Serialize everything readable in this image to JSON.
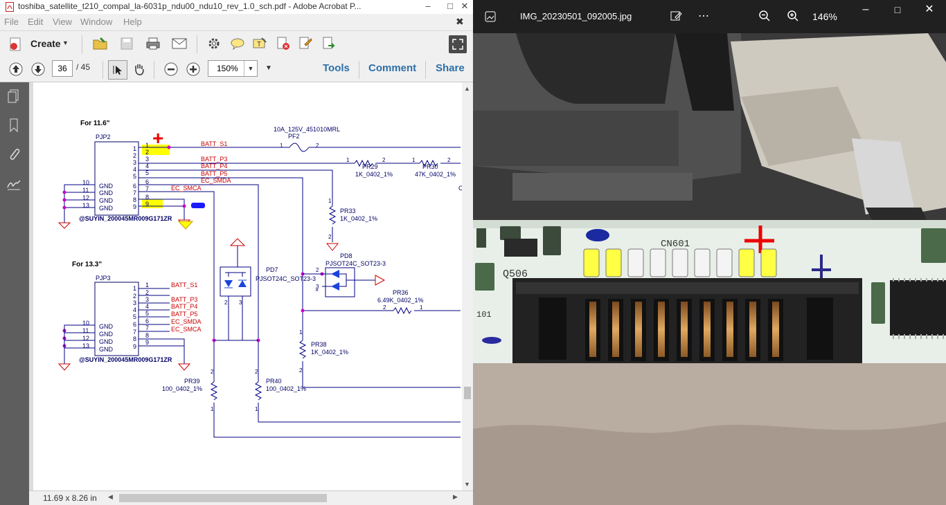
{
  "acrobat": {
    "title": "toshiba_satellite_t210_compal_la-6031p_ndu00_ndu10_rev_1.0_sch.pdf - Adobe Acrobat P...",
    "menu": [
      "File",
      "Edit",
      "View",
      "Window",
      "Help"
    ],
    "toolbar": {
      "create_label": "Create"
    },
    "nav": {
      "page_current": "36",
      "page_total": "/ 45",
      "zoom": "150%"
    },
    "panes": [
      "Tools",
      "Comment",
      "Share"
    ],
    "status": {
      "page_size": "11.69 x 8.26 in"
    }
  },
  "schematic": {
    "sec1_title": "For 11.6\"",
    "sec2_title": "For 13.3\"",
    "conn1_ref": "PJP2",
    "conn2_ref": "PJP3",
    "conn_part": "@SUYIN_200045MR009G171ZR",
    "pin_numbers": [
      "1",
      "2",
      "3",
      "4",
      "5",
      "6",
      "7",
      "8",
      "9",
      "10",
      "11",
      "12",
      "13"
    ],
    "gnd": "GND",
    "nets": [
      "BATT_S1",
      "BATT_P3",
      "BATT_P4",
      "BATT_P5",
      "EC_SMDA",
      "EC_SMCA"
    ],
    "fuse_part": "10A_125V_451010MRL",
    "fuse_ref": "PF2",
    "pr29": {
      "ref": "PR29",
      "val": "1K_0402_1%"
    },
    "pr30": {
      "ref": "PR30",
      "val": "47K_0402_1%"
    },
    "pr33": {
      "ref": "PR33",
      "val": "1K_0402_1%"
    },
    "pr36": {
      "ref": "PR36",
      "val": "6.49K_0402_1%"
    },
    "pr38": {
      "ref": "PR38",
      "val": "1K_0402_1%"
    },
    "pr39": {
      "ref": "PR39",
      "val": "100_0402_1%"
    },
    "pr40": {
      "ref": "PR40",
      "val": "100_0402_1%"
    },
    "pd7": {
      "ref": "PD7",
      "val": "PJSOT24C_SOT23-3"
    },
    "pd8": {
      "ref": "PD8",
      "val": "PJSOT24C_SOT23-3"
    },
    "small_pins": [
      "1",
      "2",
      "3"
    ],
    "edge_c": "C",
    "colors": {
      "net": "#cc0000",
      "text": "#000066",
      "wire": "#000080",
      "marker": "#cc00cc",
      "highlight": "#ffff00"
    }
  },
  "photos": {
    "filename": "IMG_20230501_092005.jpg",
    "zoom": "146%",
    "board": {
      "connector_label": "CN601",
      "transistor_label": "Q506",
      "silk_101": "101"
    }
  }
}
